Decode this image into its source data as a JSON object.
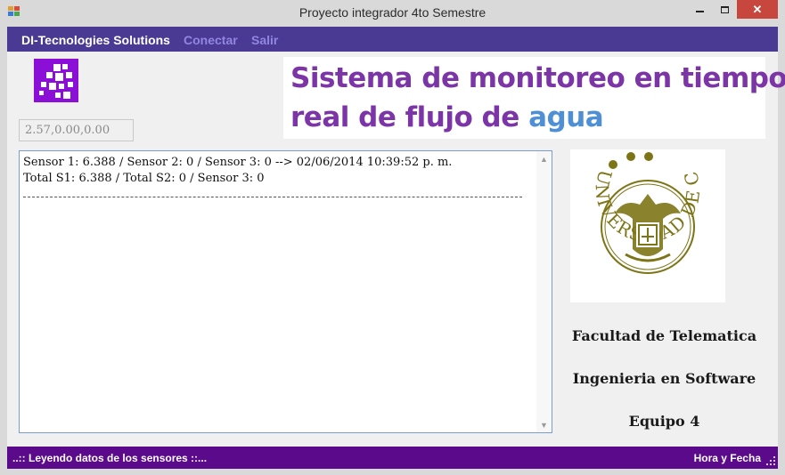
{
  "window": {
    "title": "Proyecto integrador 4to Semestre",
    "close_glyph": "✕"
  },
  "menu": {
    "brand": "DI-Tecnologies  Solutions",
    "conectar": "Conectar",
    "salir": "Salir"
  },
  "reading": {
    "value": "2.57,0.00,0.00"
  },
  "banner": {
    "line1": "Sistema de monitoreo en tiempo",
    "line2_prefix": "real de flujo de ",
    "line2_accent": "agua"
  },
  "log": {
    "lines": [
      "Sensor 1: 6.388 / Sensor 2: 0 / Sensor 3: 0 --> 02/06/2014 10:39:52 p. m.",
      "Total S1: 6.388 / Total S2: 0 / Sensor 3: 0"
    ]
  },
  "seal": {
    "text": "UNIVERSIDAD DE COLIMA"
  },
  "info": {
    "faculty": "Facultad de Telematica",
    "program": "Ingenieria en Software",
    "team": "Equipo 4"
  },
  "status": {
    "left": "..:: Leyendo datos de los sensores ::...",
    "right": "Hora y Fecha"
  },
  "colors": {
    "menubar": "#4b3a94",
    "statusbar": "#5a0a8a",
    "banner_text": "#7c35a6",
    "banner_accent": "#4f8fd6",
    "logo": "#8b0fd6",
    "seal": "#7d7415",
    "close_button": "#c7463d"
  }
}
